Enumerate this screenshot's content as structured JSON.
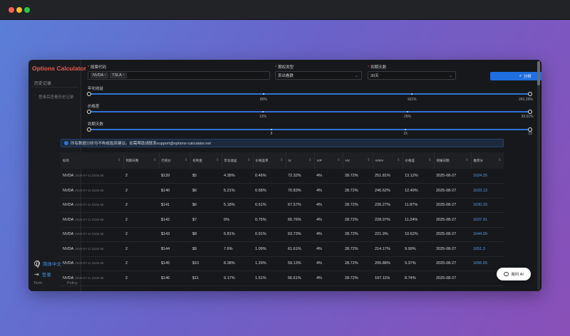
{
  "app": {
    "brand": "Options Calculator",
    "sidebar": {
      "history": "历史记录",
      "login_history": "登录后查看历史记录",
      "language": "简体中文",
      "login": "登录",
      "term": "Term",
      "policy": "Policy"
    },
    "form": {
      "symbol_label": "股票代码",
      "symbols": [
        "NVDA",
        "TSLA"
      ],
      "strategy_label": "期权类型",
      "strategy_value": "卖出看跌",
      "expiry_label": "到期天数",
      "expiry_value": "30天",
      "analyze_button": "分析"
    },
    "sliders": {
      "yield": {
        "label": "年化收益",
        "marks": [
          "80%",
          "161%",
          "241.29%"
        ],
        "min": 0,
        "max": 241.29
      },
      "price_diff": {
        "label": "价格差",
        "marks": [
          "13%",
          "26%",
          "39.51%"
        ],
        "min": 0,
        "max": 39.51
      },
      "days": {
        "label": "到期天数",
        "marks": [
          "8",
          "15",
          "23"
        ],
        "min": 1,
        "max": 23
      }
    },
    "info": "所有数据分析均不构成投资建议。如需帮助请联系support@options-calculator.net",
    "table": {
      "headers": [
        "标的",
        "到期天数",
        "行权价",
        "权利金",
        "年化收益",
        "价格差率",
        "IV",
        "IVP",
        "HV",
        "IV/HV",
        "价格差",
        "财报日期",
        "推荐分"
      ],
      "rows": [
        {
          "symbol": "NVDA",
          "date": "2025-07-11 $158.88",
          "days": "2",
          "strike": "$139",
          "premium": "$5",
          "yield": "4.38%",
          "diff_rate": "0.46%",
          "iv": "72.32%",
          "ivp": "4%",
          "hv": "28.72%",
          "ivhv": "251.81%",
          "diff": "13.12%",
          "earnings": "2025-08-27",
          "score": "1624.35"
        },
        {
          "symbol": "NVDA",
          "date": "2025-07-11 $158.88",
          "days": "2",
          "strike": "$140",
          "premium": "$6",
          "yield": "5.21%",
          "diff_rate": "0.58%",
          "iv": "70.83%",
          "ivp": "4%",
          "hv": "28.72%",
          "ivhv": "246.62%",
          "diff": "12.49%",
          "earnings": "2025-08-27",
          "score": "1633.13"
        },
        {
          "symbol": "NVDA",
          "date": "2025-07-11 $158.88",
          "days": "2",
          "strike": "$141",
          "premium": "$6",
          "yield": "5.18%",
          "diff_rate": "0.61%",
          "iv": "67.57%",
          "ivp": "4%",
          "hv": "28.72%",
          "ivhv": "235.27%",
          "diff": "11.87%",
          "earnings": "2025-08-27",
          "score": "1630.33"
        },
        {
          "symbol": "NVDA",
          "date": "2025-07-11 $158.88",
          "days": "2",
          "strike": "$142",
          "premium": "$7",
          "yield": "6%",
          "diff_rate": "0.75%",
          "iv": "65.76%",
          "ivp": "4%",
          "hv": "28.72%",
          "ivhv": "228.97%",
          "diff": "11.24%",
          "earnings": "2025-08-27",
          "score": "1637.91"
        },
        {
          "symbol": "NVDA",
          "date": "2025-07-11 $158.88",
          "days": "2",
          "strike": "$143",
          "premium": "$8",
          "yield": "6.81%",
          "diff_rate": "0.91%",
          "iv": "63.73%",
          "ivp": "4%",
          "hv": "28.72%",
          "ivhv": "221.9%",
          "diff": "10.62%",
          "earnings": "2025-08-27",
          "score": "1644.99"
        },
        {
          "symbol": "NVDA",
          "date": "2025-07-11 $158.88",
          "days": "2",
          "strike": "$144",
          "premium": "$9",
          "yield": "7.6%",
          "diff_rate": "1.09%",
          "iv": "61.61%",
          "ivp": "4%",
          "hv": "28.72%",
          "ivhv": "214.17%",
          "diff": "9.99%",
          "earnings": "2025-08-27",
          "score": "1651.3"
        },
        {
          "symbol": "NVDA",
          "date": "2025-07-11 $158.88",
          "days": "2",
          "strike": "$145",
          "premium": "$10",
          "yield": "8.38%",
          "diff_rate": "1.29%",
          "iv": "59.13%",
          "ivp": "4%",
          "hv": "28.72%",
          "ivhv": "205.88%",
          "diff": "9.37%",
          "earnings": "2025-08-27",
          "score": "1656.55"
        },
        {
          "symbol": "NVDA",
          "date": "2025-07-11 $158.88",
          "days": "2",
          "strike": "$146",
          "premium": "$11",
          "yield": "9.17%",
          "diff_rate": "1.51%",
          "iv": "56.61%",
          "ivp": "4%",
          "hv": "28.72%",
          "ivhv": "197.11%",
          "diff": "8.74%",
          "earnings": "2025-08-27",
          "score": ""
        }
      ]
    },
    "ai_button": "询问 AI"
  },
  "colors": {
    "accent": "#1f6fe0",
    "brand": "#ee5a4f",
    "score": "#5a9ce8"
  }
}
